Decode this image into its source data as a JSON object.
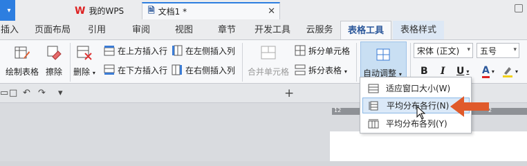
{
  "title_bar": {
    "quick_menu_icon": "chevron-down-icon"
  },
  "menu": {
    "tabs": [
      {
        "label": "插入"
      },
      {
        "label": "页面布局"
      },
      {
        "label": "引用"
      },
      {
        "label": "审阅"
      },
      {
        "label": "视图"
      },
      {
        "label": "章节"
      },
      {
        "label": "开发工具"
      },
      {
        "label": "云服务"
      },
      {
        "label": "表格工具"
      },
      {
        "label": "表格样式"
      }
    ],
    "active_tab": "表格工具"
  },
  "ribbon": {
    "draw_table": "绘制表格",
    "eraser": "擦除",
    "delete": "删除",
    "insert_above": "在上方插入行",
    "insert_below": "在下方插入行",
    "insert_left": "在左侧插入列",
    "insert_right": "在右侧插入列",
    "merge_cells": "合并单元格",
    "split_cells": "拆分单元格",
    "split_table": "拆分表格",
    "autofit": "自动调整",
    "font_name": "宋体 (正文)",
    "font_size": "五号",
    "bold": "B",
    "italic": "I",
    "underline": "U",
    "font_color": "A"
  },
  "docbar": {
    "tabs": [
      {
        "label": "我的WPS"
      },
      {
        "label": "文档1 *"
      }
    ],
    "new_tab": "+"
  },
  "ruler": {
    "tick_left": "12",
    "tick_right": "2"
  },
  "autofit_menu": {
    "items": [
      {
        "label": "适应窗口大小(W)"
      },
      {
        "label": "平均分布各行(N)"
      },
      {
        "label": "平均分布各列(Y)"
      }
    ],
    "highlighted_index": 1
  },
  "colors": {
    "accent": "#2d7ee0",
    "annotation_arrow": "#e05a2b",
    "menu_highlight": "#dbe9f8"
  }
}
